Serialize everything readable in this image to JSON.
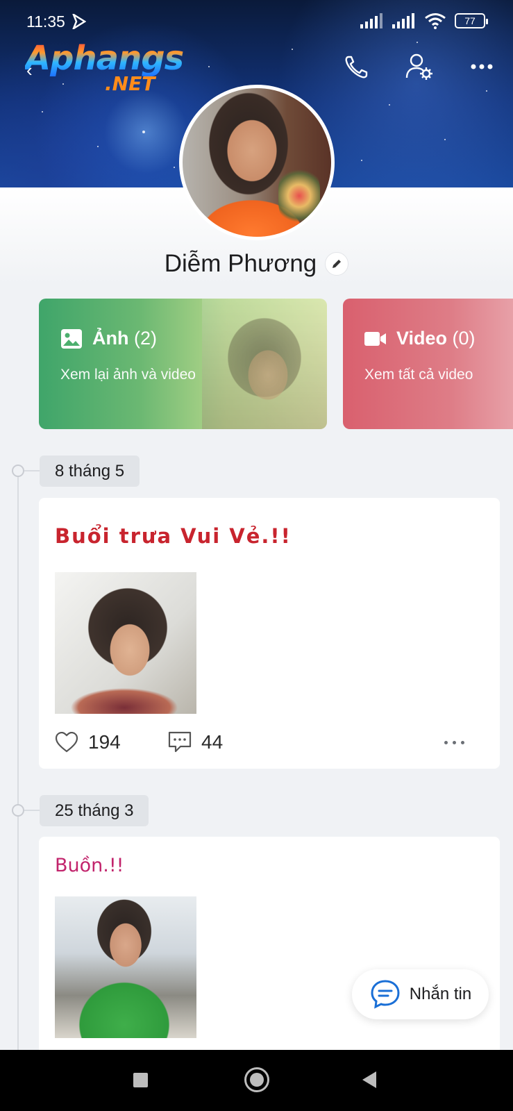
{
  "status_bar": {
    "time": "11:35",
    "battery": "77"
  },
  "watermark": {
    "brand": "Aphangs",
    "suffix": ".NET"
  },
  "header": {
    "icons": [
      "back-chevron-icon",
      "phone-icon",
      "user-settings-icon",
      "more-icon"
    ]
  },
  "profile": {
    "name": "Diễm Phương"
  },
  "media_cards": [
    {
      "title": "Ảnh",
      "count": "(2)",
      "subtitle": "Xem lại ảnh và video",
      "icon": "image-icon",
      "color": "#4caf6e"
    },
    {
      "title": "Video",
      "count": "(0)",
      "subtitle": "Xem tất cả video",
      "icon": "video-camera-icon",
      "color": "#d9606e"
    }
  ],
  "timeline": [
    {
      "date": "8 tháng 5",
      "text": "Buổi trưa Vui Vẻ.!!",
      "likes": "194",
      "comments": "44"
    },
    {
      "date": "25 tháng 3",
      "text": "Buồn.!!"
    }
  ],
  "fab": {
    "label": "Nhắn tin"
  },
  "colors": {
    "post1_text": "#c8242e",
    "post2_text": "#c2246c",
    "fab_icon": "#1a6fd6"
  }
}
